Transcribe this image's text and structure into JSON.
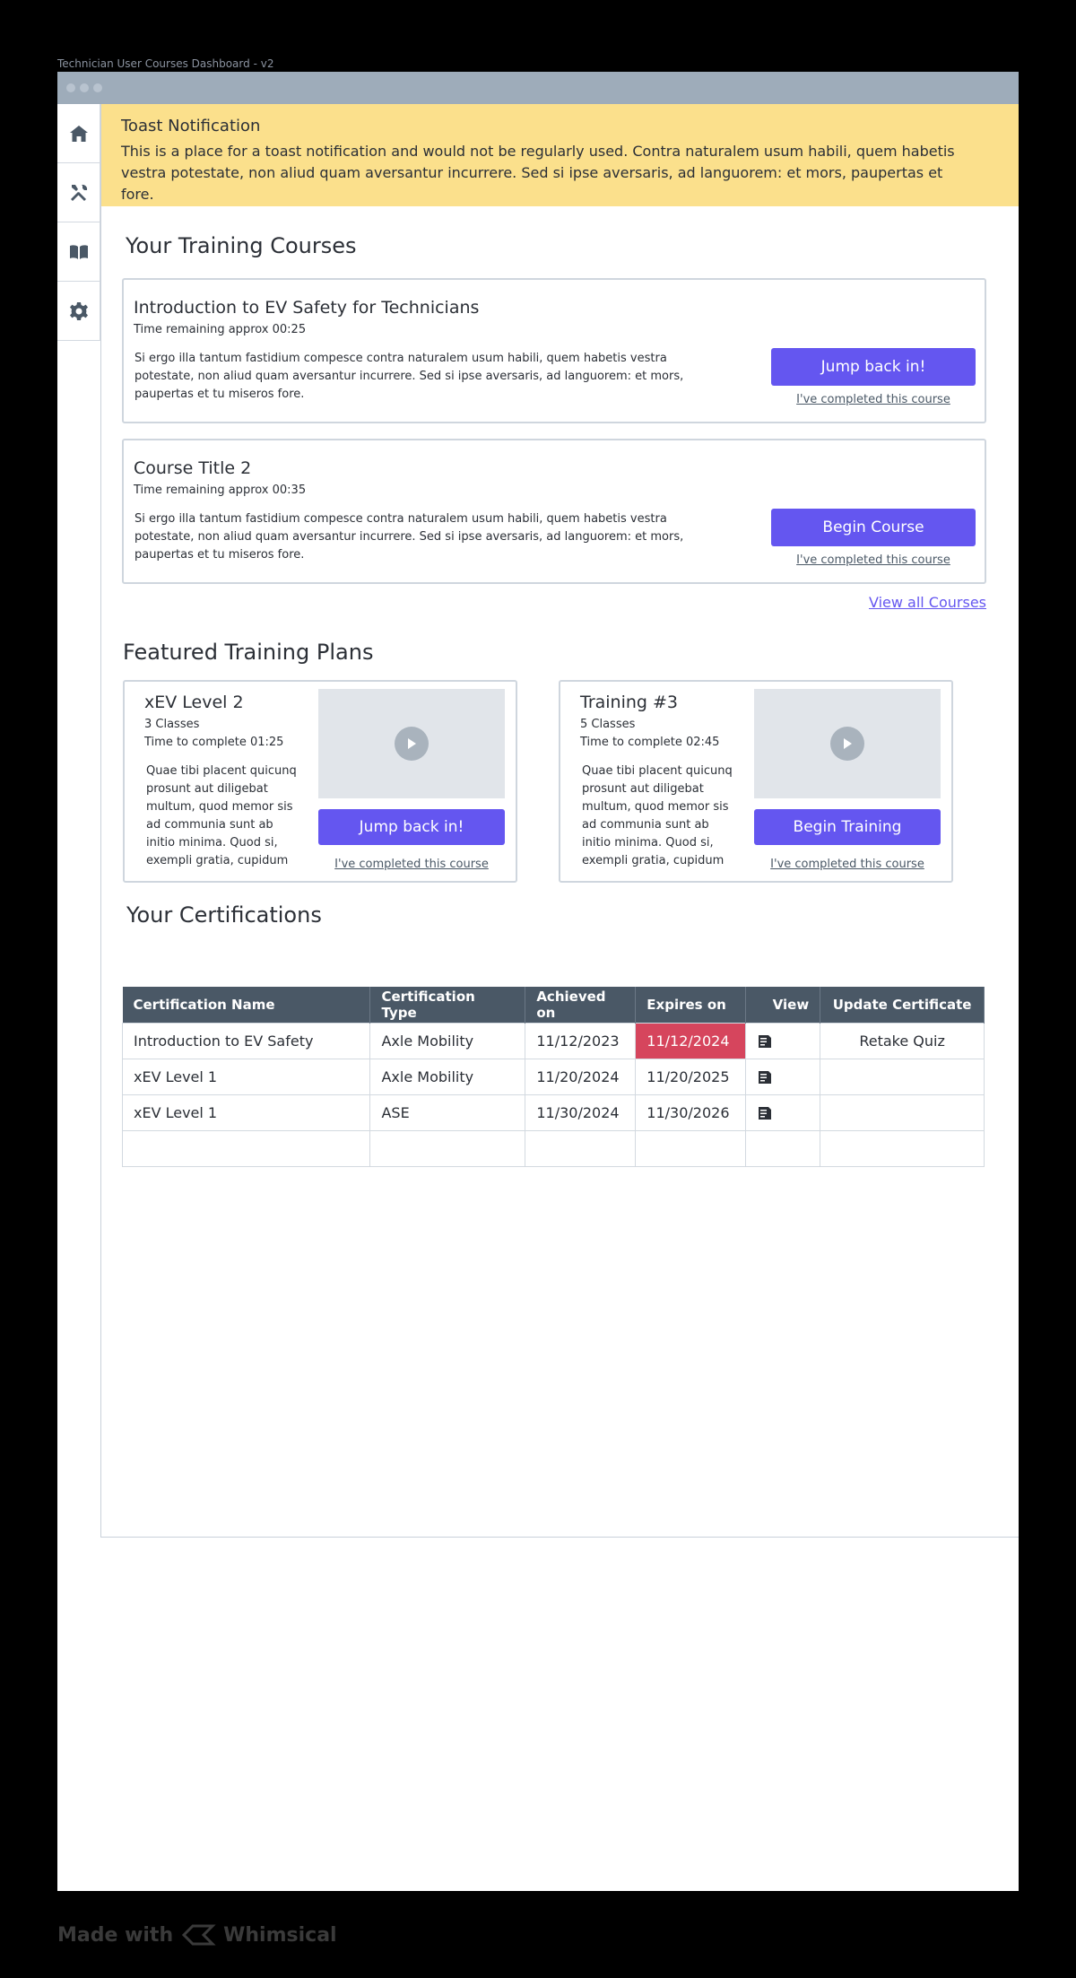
{
  "frame_label": "Technician User Courses Dashboard - v2",
  "sidebar": {
    "items": [
      {
        "name": "home",
        "icon": "home-icon"
      },
      {
        "name": "tools",
        "icon": "tools-icon"
      },
      {
        "name": "courses",
        "icon": "book-icon"
      },
      {
        "name": "settings",
        "icon": "gear-icon"
      }
    ]
  },
  "toast": {
    "title": "Toast Notification",
    "message": "This is a place for a toast notification and would not be regularly used. Contra naturalem usum habili, quem habetis vestra potestate, non aliud quam aversantur incurrere. Sed si ipse aversaris, ad languorem: et mors, paupertas et fore."
  },
  "training_courses": {
    "heading": "Your Training Courses",
    "courses": [
      {
        "title": "Introduction to EV Safety for Technicians",
        "time": "Time remaining approx 00:25",
        "description": "Si ergo illa tantum fastidium compesce contra naturalem usum habili, quem habetis vestra potestate, non aliud quam aversantur incurrere. Sed si ipse aversaris, ad languorem: et mors, paupertas et tu miseros fore.",
        "button": "Jump back in!",
        "link": "I've completed this course"
      },
      {
        "title": "Course Title 2",
        "time": "Time remaining approx 00:35",
        "description": "Si ergo illa tantum fastidium compesce contra naturalem usum habili, quem habetis vestra potestate, non aliud quam aversantur incurrere. Sed si ipse aversaris, ad languorem: et mors, paupertas et tu miseros fore.",
        "button": "Begin Course",
        "link": "I've completed this course"
      }
    ],
    "view_all": "View all Courses"
  },
  "featured_plans": {
    "heading": "Featured Training Plans",
    "plans": [
      {
        "title": "xEV Level 2",
        "classes": "3 Classes",
        "time": "Time to complete 01:25",
        "description": "Quae tibi placent quicunq prosunt aut diligebat multum, quod memor sis ad communia sunt ab initio minima. Quod si, exempli gratia, cupidum",
        "button": "Jump back in!",
        "link": "I've completed this course"
      },
      {
        "title": "Training #3",
        "classes": "5 Classes",
        "time": "Time to complete 02:45",
        "description": "Quae tibi placent quicunq prosunt aut diligebat multum, quod memor sis ad communia sunt ab initio minima. Quod si, exempli gratia, cupidum",
        "button": "Begin Training",
        "link": "I've completed this course"
      }
    ]
  },
  "certifications": {
    "heading": "Your Certifications",
    "columns": [
      "Certification Name",
      "Certification Type",
      "Achieved on",
      "Expires on",
      "View",
      "Update Certificate"
    ],
    "rows": [
      {
        "name": "Introduction to EV Safety",
        "type": "Axle Mobility",
        "achieved": "11/12/2023",
        "expires": "11/12/2024",
        "expired": true,
        "view_icon": "document-icon",
        "update": "Retake Quiz"
      },
      {
        "name": "xEV Level 1",
        "type": "Axle Mobility",
        "achieved": "11/20/2024",
        "expires": "11/20/2025",
        "expired": false,
        "view_icon": "document-icon",
        "update": ""
      },
      {
        "name": "xEV Level 1",
        "type": "ASE",
        "achieved": "11/30/2024",
        "expires": "11/30/2026",
        "expired": false,
        "view_icon": "document-icon",
        "update": ""
      },
      {
        "name": "",
        "type": "",
        "achieved": "",
        "expires": "",
        "expired": false,
        "view_icon": "",
        "update": ""
      }
    ]
  },
  "footer": {
    "made_with": "Made with",
    "brand": "Whimsical"
  },
  "colors": {
    "accent": "#6456f0",
    "toast_bg": "#fbe08c",
    "table_header": "#4a5866",
    "expired": "#d6455d",
    "titlebar": "#9eacba"
  }
}
